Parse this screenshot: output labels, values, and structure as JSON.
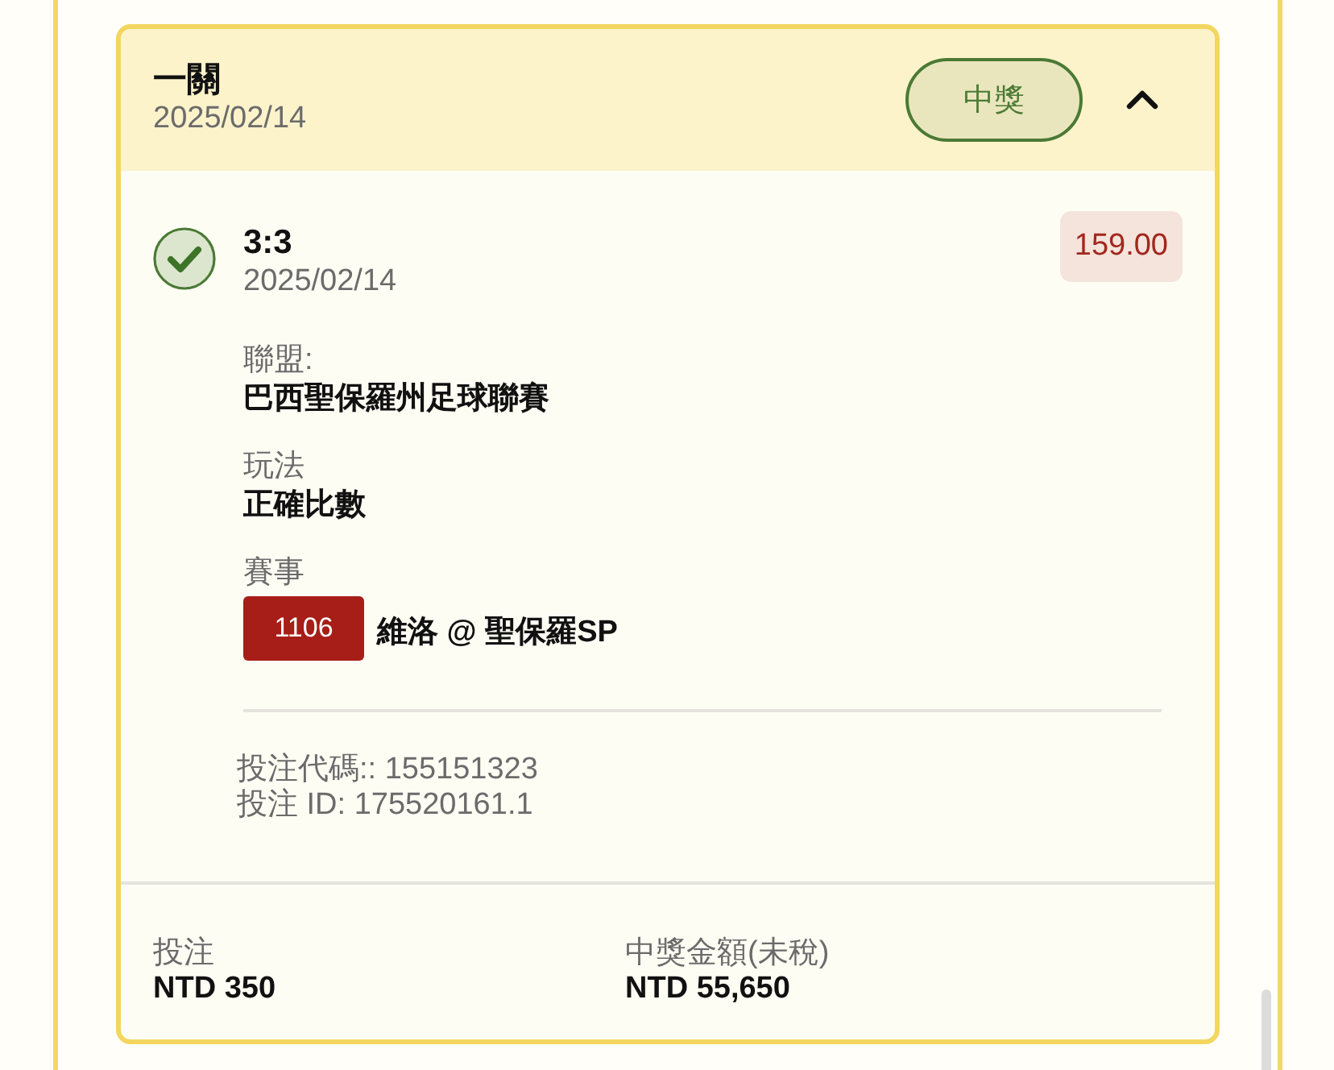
{
  "bet": {
    "title": "一關",
    "date": "2025/02/14",
    "status_badge": "中獎",
    "expanded": true
  },
  "selection": {
    "won": true,
    "score": "3:3",
    "date": "2025/02/14",
    "odds": "159.00",
    "details": [
      {
        "kind": "text",
        "label": "聯盟:",
        "value": "巴西聖保羅州足球聯賽"
      },
      {
        "kind": "text",
        "label": "玩法",
        "value": "正確比數"
      },
      {
        "kind": "match",
        "label": "賽事",
        "match_code": "1106",
        "value": "維洛 @ 聖保羅SP"
      }
    ],
    "codes": [
      "投注代碼:: 155151323",
      "投注 ID: 175520161.1"
    ]
  },
  "summary": [
    {
      "label": "投注",
      "value": "NTD 350"
    },
    {
      "label": "中獎金額(未稅)",
      "value": "NTD 55,650"
    }
  ]
}
